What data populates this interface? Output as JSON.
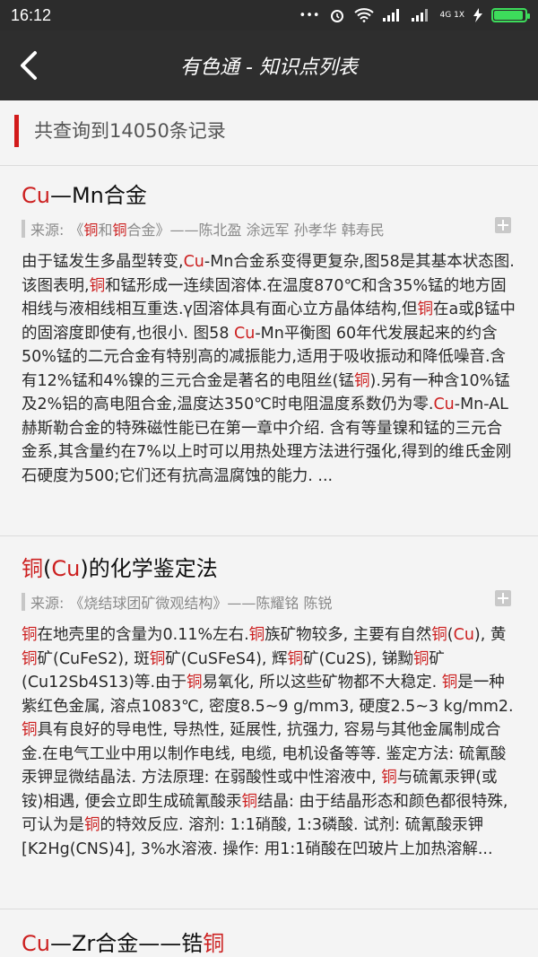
{
  "status": {
    "time": "16:12",
    "network": "4G 1X"
  },
  "app_bar": {
    "title": "有色通 - 知识点列表"
  },
  "summary": {
    "count_text": "共查询到14050条记录"
  },
  "source_label": "来源:",
  "items": [
    {
      "title_segments": [
        {
          "t": "Cu",
          "hl": true
        },
        {
          "t": "—Mn合金",
          "hl": false
        }
      ],
      "source_segments": [
        {
          "t": "《",
          "hl": false
        },
        {
          "t": "铜",
          "hl": true
        },
        {
          "t": "和",
          "hl": false
        },
        {
          "t": "铜",
          "hl": true
        },
        {
          "t": "合金》——陈北盈 涂远军 孙孝华 韩寿民",
          "hl": false
        }
      ],
      "body_segments": [
        {
          "t": "由于锰发生多晶型转变,",
          "hl": false
        },
        {
          "t": "Cu",
          "hl": true
        },
        {
          "t": "-Mn合金系变得更复杂,图58是其基本状态图.该图表明,",
          "hl": false
        },
        {
          "t": "铜",
          "hl": true
        },
        {
          "t": "和锰形成一连续固溶体.在温度870℃和含35%锰的地方固相线与液相线相互重迭.γ固溶体具有面心立方晶体结构,但",
          "hl": false
        },
        {
          "t": "铜",
          "hl": true
        },
        {
          "t": "在a或β锰中的固溶度即使有,也很小. 图58 ",
          "hl": false
        },
        {
          "t": "Cu",
          "hl": true
        },
        {
          "t": "-Mn平衡图 60年代发展起来的约含50%锰的二元合金有特别高的减振能力,适用于吸收振动和降低噪音.含有12%锰和4%镍的三元合金是著名的电阻丝(锰",
          "hl": false
        },
        {
          "t": "铜",
          "hl": true
        },
        {
          "t": ").另有一种含10%锰及2%铝的高电阻合金,温度达350℃时电阻温度系数仍为零.",
          "hl": false
        },
        {
          "t": "Cu",
          "hl": true
        },
        {
          "t": "-Mn-AL赫斯勒合金的特殊磁性能已在第一章中介绍. 含有等量镍和锰的三元合金系,其含量约在7%以上时可以用热处理方法进行强化,得到的维氏金刚石硬度为500;它们还有抗高温腐蚀的能力. ...",
          "hl": false
        }
      ]
    },
    {
      "title_segments": [
        {
          "t": "铜",
          "hl": true
        },
        {
          "t": "(",
          "hl": false
        },
        {
          "t": "Cu",
          "hl": true
        },
        {
          "t": ")的化学鉴定法",
          "hl": false
        }
      ],
      "source_segments": [
        {
          "t": "《烧结球团矿微观结构》——陈耀铭 陈锐",
          "hl": false
        }
      ],
      "body_segments": [
        {
          "t": "铜",
          "hl": true
        },
        {
          "t": "在地壳里的含量为0.11%左右.",
          "hl": false
        },
        {
          "t": "铜",
          "hl": true
        },
        {
          "t": "族矿物较多, 主要有自然",
          "hl": false
        },
        {
          "t": "铜",
          "hl": true
        },
        {
          "t": "(",
          "hl": false
        },
        {
          "t": "Cu",
          "hl": true
        },
        {
          "t": "), 黄",
          "hl": false
        },
        {
          "t": "铜",
          "hl": true
        },
        {
          "t": "矿(CuFeS2), 斑",
          "hl": false
        },
        {
          "t": "铜",
          "hl": true
        },
        {
          "t": "矿(CuSFeS4), 辉",
          "hl": false
        },
        {
          "t": "铜",
          "hl": true
        },
        {
          "t": "矿(Cu2S), 锑黝",
          "hl": false
        },
        {
          "t": "铜",
          "hl": true
        },
        {
          "t": "矿(Cu12Sb4S13)等.由于",
          "hl": false
        },
        {
          "t": "铜",
          "hl": true
        },
        {
          "t": "易氧化, 所以这些矿物都不大稳定. ",
          "hl": false
        },
        {
          "t": "铜",
          "hl": true
        },
        {
          "t": "是一种紫红色金属, 溶点1083℃, 密度8.5~9 g/mm3, 硬度2.5~3 kg/mm2.",
          "hl": false
        },
        {
          "t": "铜",
          "hl": true
        },
        {
          "t": "具有良好的导电性, 导热性, 延展性, 抗强力, 容易与其他金属制成合金.在电气工业中用以制作电线, 电缆, 电机设备等等. 鉴定方法: 硫氰酸汞钾显微结晶法. 方法原理: 在弱酸性或中性溶液中, ",
          "hl": false
        },
        {
          "t": "铜",
          "hl": true
        },
        {
          "t": "与硫氰汞钾(或铵)相遇, 便会立即生成硫氰酸汞",
          "hl": false
        },
        {
          "t": "铜",
          "hl": true
        },
        {
          "t": "结晶: 由于结晶形态和颜色都很特殊, 可认为是",
          "hl": false
        },
        {
          "t": "铜",
          "hl": true
        },
        {
          "t": "的特效反应. 溶剂: 1:1硝酸, 1:3磷酸. 试剂: 硫氰酸汞钾[K2Hg(CNS)4], 3%水溶液. 操作: 用1:1硝酸在凹玻片上加热溶解...",
          "hl": false
        }
      ]
    },
    {
      "title_segments": [
        {
          "t": "Cu",
          "hl": true
        },
        {
          "t": "—Zr合金——锆",
          "hl": false
        },
        {
          "t": "铜",
          "hl": true
        }
      ]
    }
  ]
}
